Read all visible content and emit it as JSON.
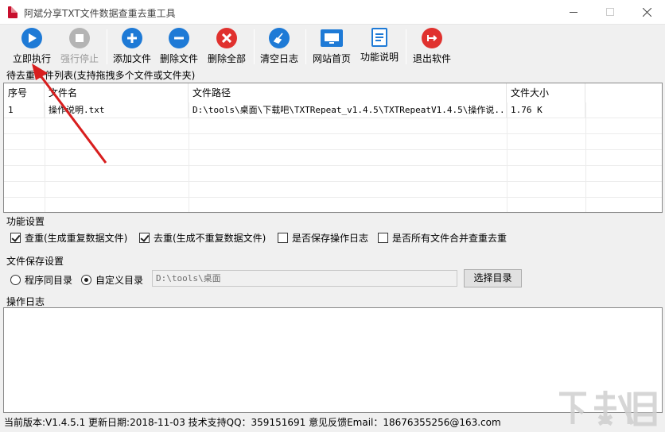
{
  "window": {
    "title": "阿斌分享TXT文件数据查重去重工具",
    "min_label": "—",
    "max_label": "☐",
    "close_label": "✕"
  },
  "toolbar": {
    "execute": "立即执行",
    "stop": "强行停止",
    "add_file": "添加文件",
    "delete_file": "删除文件",
    "delete_all": "删除全部",
    "clear_log": "清空日志",
    "website": "网站首页",
    "help": "功能说明",
    "exit": "退出软件"
  },
  "icons": {
    "execute": "play-icon",
    "stop": "stop-icon",
    "add_file": "plus-icon",
    "delete_file": "minus-icon",
    "delete_all": "x-icon",
    "clear_log": "broom-icon",
    "website": "monitor-icon",
    "help": "document-icon",
    "exit": "exit-icon"
  },
  "colors": {
    "blue": "#1e7ad6",
    "red": "#e0312e",
    "gray": "#b4b4b4",
    "arrow": "#d81e1e"
  },
  "file_list": {
    "label": "待去重文件列表(支持拖拽多个文件或文件夹)",
    "columns": [
      "序号",
      "文件名",
      "文件路径",
      "文件大小"
    ],
    "rows": [
      {
        "index": "1",
        "name": "操作说明.txt",
        "path": "D:\\tools\\桌面\\下载吧\\TXTRepeat_v1.4.5\\TXTRepeatV1.4.5\\操作说...",
        "size": "1.76 K"
      }
    ]
  },
  "settings": {
    "label": "功能设置",
    "check_dup": "查重(生成重复数据文件)",
    "remove_dup": "去重(生成不重复数据文件)",
    "save_log": "是否保存操作日志",
    "merge_all": "是否所有文件合并查重去重",
    "check_dup_checked": true,
    "remove_dup_checked": true,
    "save_log_checked": false,
    "merge_all_checked": false
  },
  "save": {
    "label": "文件保存设置",
    "same_dir": "程序同目录",
    "custom_dir": "自定义目录",
    "path": "D:\\tools\\桌面",
    "choose_button": "选择目录",
    "selected": "custom_dir"
  },
  "log": {
    "label": "操作日志"
  },
  "status": {
    "text": "当前版本:V1.4.5.1    更新日期:2018-11-03    技术支持QQ：359151691    意见反馈Email：18676355256@163.com"
  },
  "watermark": {
    "text": "下载吧"
  }
}
